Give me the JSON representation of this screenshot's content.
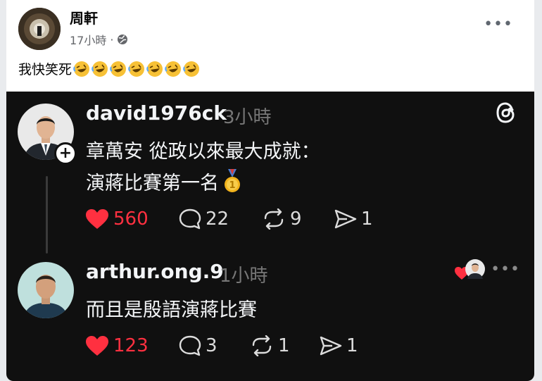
{
  "post": {
    "author": "周軒",
    "time": "17小時",
    "separator": "·",
    "text": "我快笑死",
    "emoji_icons": [
      "rolling-on-floor-laughing-icon",
      "rolling-on-floor-laughing-icon",
      "rolling-on-floor-laughing-icon",
      "rolling-on-floor-laughing-icon",
      "rolling-on-floor-laughing-icon",
      "rolling-on-floor-laughing-icon",
      "rolling-on-floor-laughing-icon"
    ],
    "more_label": "•••"
  },
  "threads": {
    "logo_icon": "threads-logo-icon",
    "main": {
      "username": "david1976ck",
      "time": "3小時",
      "lines": [
        "章萬安 從政以來最大成就：",
        "演蔣比賽第一名"
      ],
      "medal_icon": "first-place-medal-icon",
      "likes": "560",
      "comments": "22",
      "reposts": "9",
      "shares": "1"
    },
    "reply": {
      "username": "arthur.ong.9",
      "time": "1小時",
      "text": "而且是殷語演蔣比賽",
      "likes": "123",
      "comments": "3",
      "reposts": "1",
      "shares": "1",
      "more_label": "•••"
    },
    "colors": {
      "background": "#101010",
      "like_red": "#ff3040",
      "muted": "#777777"
    }
  }
}
